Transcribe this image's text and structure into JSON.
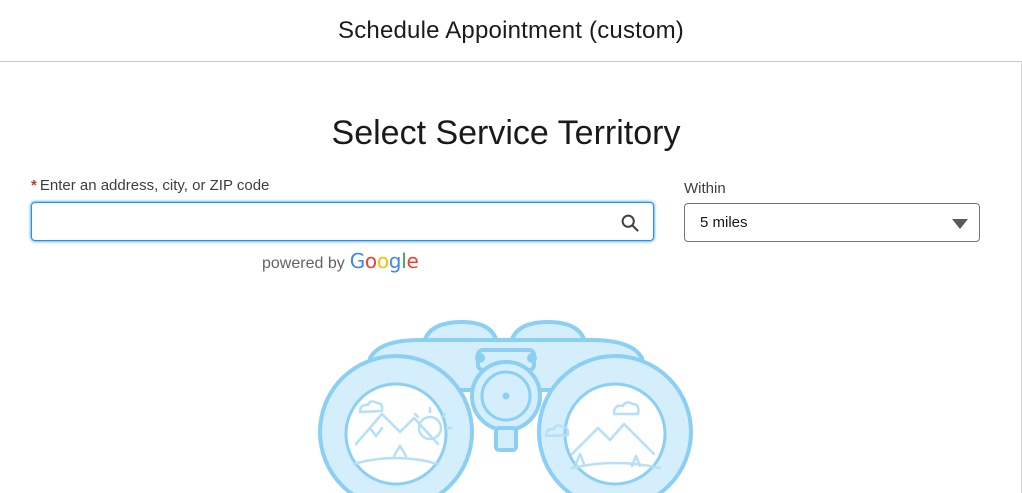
{
  "header": {
    "title": "Schedule Appointment (custom)"
  },
  "main": {
    "title": "Select Service Territory",
    "address_field": {
      "required_marker": "*",
      "label": "Enter an address, city, or ZIP code",
      "value": "",
      "placeholder": ""
    },
    "powered_by": {
      "text": "powered by",
      "logo_letters": [
        "G",
        "o",
        "o",
        "g",
        "l",
        "e"
      ],
      "logo_colors": [
        "#4285F4",
        "#EA4335",
        "#FBBC05",
        "#4285F4",
        "#34A853",
        "#EA4335"
      ]
    },
    "within": {
      "label": "Within",
      "selected": "5 miles"
    },
    "illustration": {
      "icon": "binoculars-illustration"
    }
  },
  "colors": {
    "focus_border": "#1b96ff",
    "required": "#c23934",
    "illustration_stroke": "#8ccff4",
    "illustration_fill": "#d4eefc"
  }
}
